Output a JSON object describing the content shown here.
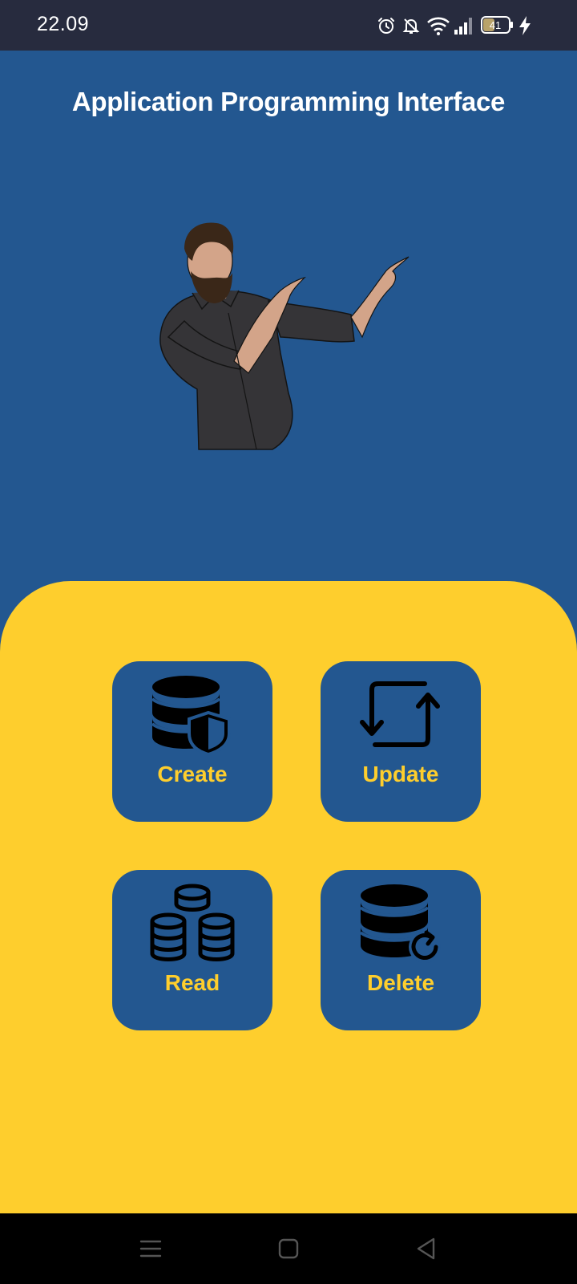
{
  "status_bar": {
    "time": "22.09",
    "battery": "41",
    "icons": [
      "alarm-icon",
      "bell-off-icon",
      "wifi-icon",
      "signal-icon",
      "battery-icon",
      "charging-bolt-icon"
    ]
  },
  "header": {
    "title": "Application Programming Interface"
  },
  "hero": {
    "illustration": "man-pointing-illustration"
  },
  "actions": [
    {
      "label": "Create",
      "icon": "database-shield-icon"
    },
    {
      "label": "Update",
      "icon": "refresh-arrows-icon"
    },
    {
      "label": "Read",
      "icon": "database-stack-icon"
    },
    {
      "label": "Delete",
      "icon": "database-refresh-icon"
    }
  ],
  "nav_bar": {
    "buttons": [
      "menu-icon",
      "home-icon",
      "back-icon"
    ]
  },
  "colors": {
    "primary_blue": "#235790",
    "accent_yellow": "#fece2d",
    "status_bar": "#272b3e"
  }
}
